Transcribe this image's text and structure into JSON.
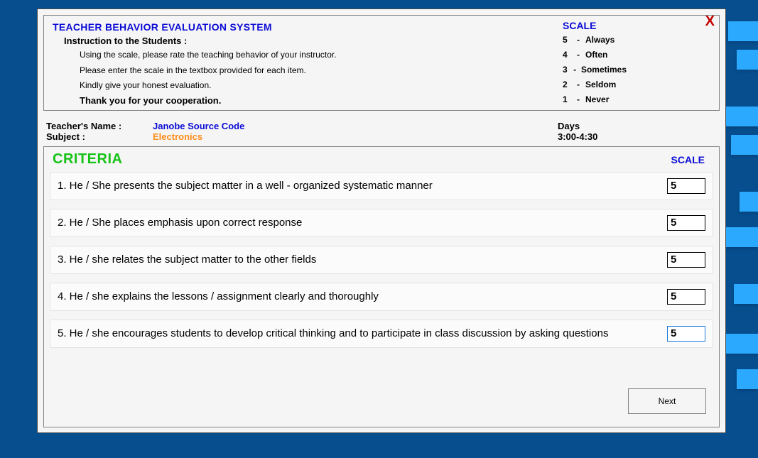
{
  "header": {
    "title": "TEACHER BEHAVIOR EVALUATION SYSTEM",
    "close_label": "X",
    "instruction_heading": "Instruction to the Students :",
    "instructions": [
      "Using the scale, please rate the teaching behavior of your instructor.",
      "Please enter the scale in the textbox provided for each item.",
      "Kindly give your honest evaluation."
    ],
    "thanks": "Thank you for your cooperation."
  },
  "scale": {
    "title": "SCALE",
    "items": [
      {
        "num": "5",
        "label": "Always"
      },
      {
        "num": "4",
        "label": "Often"
      },
      {
        "num": "3",
        "label": "Sometimes"
      },
      {
        "num": "2",
        "label": "Seldom"
      },
      {
        "num": "1",
        "label": "Never"
      }
    ]
  },
  "teacher": {
    "name_label": "Teacher's Name :",
    "name_value": "Janobe Source Code",
    "subject_label": "Subject :",
    "subject_value": "Electronics",
    "days_label": "Days",
    "time_value": "3:00-4:30"
  },
  "criteria": {
    "title": "CRITERIA",
    "scale_head": "SCALE",
    "questions": [
      {
        "text": "1. He / She presents the subject matter in a well - organized systematic manner",
        "value": "5"
      },
      {
        "text": "2. He / She places emphasis upon correct response",
        "value": "5"
      },
      {
        "text": "3. He / she relates the subject matter to the other fields",
        "value": "5"
      },
      {
        "text": "4. He / she explains the lessons / assignment clearly and thoroughly",
        "value": "5"
      },
      {
        "text": "5. He / she encourages students to develop critical thinking and to participate in class discussion by asking questions",
        "value": "5"
      }
    ],
    "next_label": "Next"
  }
}
